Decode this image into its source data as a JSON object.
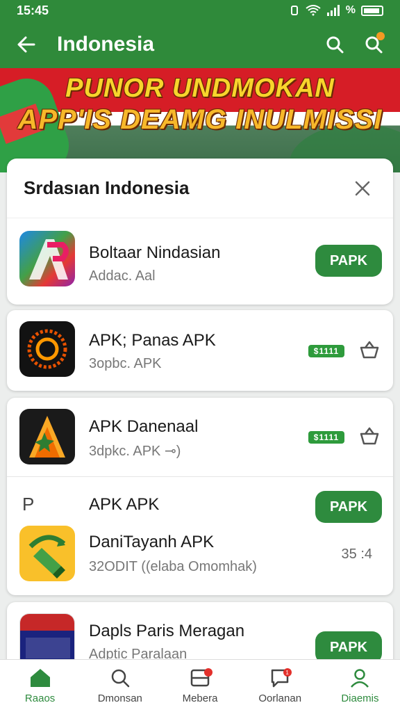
{
  "status": {
    "time": "15:45",
    "signal_text": "%"
  },
  "app_bar": {
    "title": "Indonesia",
    "back_icon": "arrow-left-icon",
    "search_icon": "search-icon",
    "notify_icon": "search-notification-icon",
    "accent": "#2f8a3a"
  },
  "banner": {
    "line1": "PUNOR UNDMOKAN",
    "line2": "APP'IS DEAMG INULMISSI"
  },
  "sheet": {
    "title": "Srdasıan Indonesia"
  },
  "apps": [
    {
      "name": "Boltaar Nindasian",
      "sub": "Addac. Aal",
      "button": "PAPK"
    },
    {
      "name": "APK; Panas APK",
      "sub": "3opbc. APK",
      "chip": "$1111"
    },
    {
      "name": "APK Danenaal",
      "sub": "3dpkc. APK ⊸)",
      "chip": "$1111"
    },
    {
      "name": "APK APK",
      "prefix": "P",
      "button": "PAPK"
    },
    {
      "name": "DaniTayanh APK",
      "sub": "32ODIT ((elaba Omomhak)",
      "rating": "35 :4"
    },
    {
      "name": "Dapls Paris Meragan",
      "sub": "Adptic Paralaan",
      "button": "PAPK"
    }
  ],
  "bottom_nav": [
    {
      "label": "Raaos",
      "icon": "home-icon",
      "active": true
    },
    {
      "label": "Dmonsan",
      "icon": "search-icon"
    },
    {
      "label": "Mebera",
      "icon": "inbox-icon",
      "badge": ""
    },
    {
      "label": "Oorlanan",
      "icon": "message-icon",
      "badge": "1"
    },
    {
      "label": "Diaemis",
      "icon": "profile-icon",
      "active": true
    }
  ]
}
